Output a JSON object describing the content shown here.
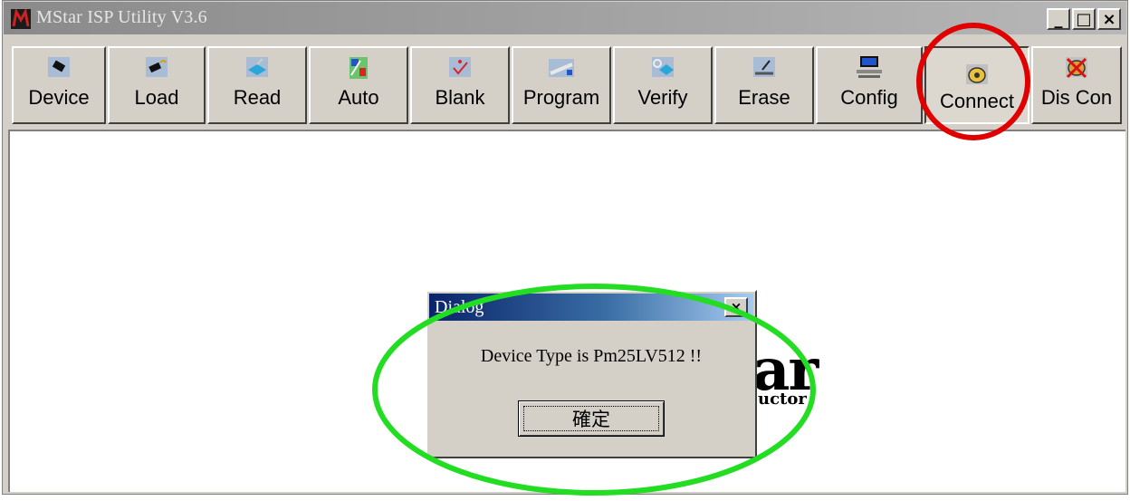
{
  "window": {
    "title": "MStar ISP Utility V3.6",
    "controls": {
      "minimize": "_",
      "maximize": "□",
      "close": "×"
    }
  },
  "toolbar": {
    "buttons": [
      {
        "label": "Device",
        "icon": "chip-icon"
      },
      {
        "label": "Load",
        "icon": "chip-load-icon"
      },
      {
        "label": "Read",
        "icon": "read-book-icon"
      },
      {
        "label": "Auto",
        "icon": "auto-grid-icon"
      },
      {
        "label": "Blank",
        "icon": "blank-check-icon"
      },
      {
        "label": "Program",
        "icon": "program-icon"
      },
      {
        "label": "Verify",
        "icon": "verify-magnifier-icon"
      },
      {
        "label": "Erase",
        "icon": "erase-icon"
      },
      {
        "label": "Config",
        "icon": "config-computer-icon"
      },
      {
        "label": "Connect",
        "icon": "telephone-icon"
      },
      {
        "label": "Dis Con",
        "icon": "telephone-disconnect-icon"
      }
    ]
  },
  "background_logo": {
    "fragment_large": "ar",
    "fragment_small": "uctor"
  },
  "dialog": {
    "title": "Dialog",
    "close": "×",
    "message": "Device Type is Pm25LV512 !!",
    "ok_label": "確定"
  },
  "annotations": {
    "connect_highlight_color": "#e00000",
    "dialog_highlight_color": "#22dd22"
  }
}
